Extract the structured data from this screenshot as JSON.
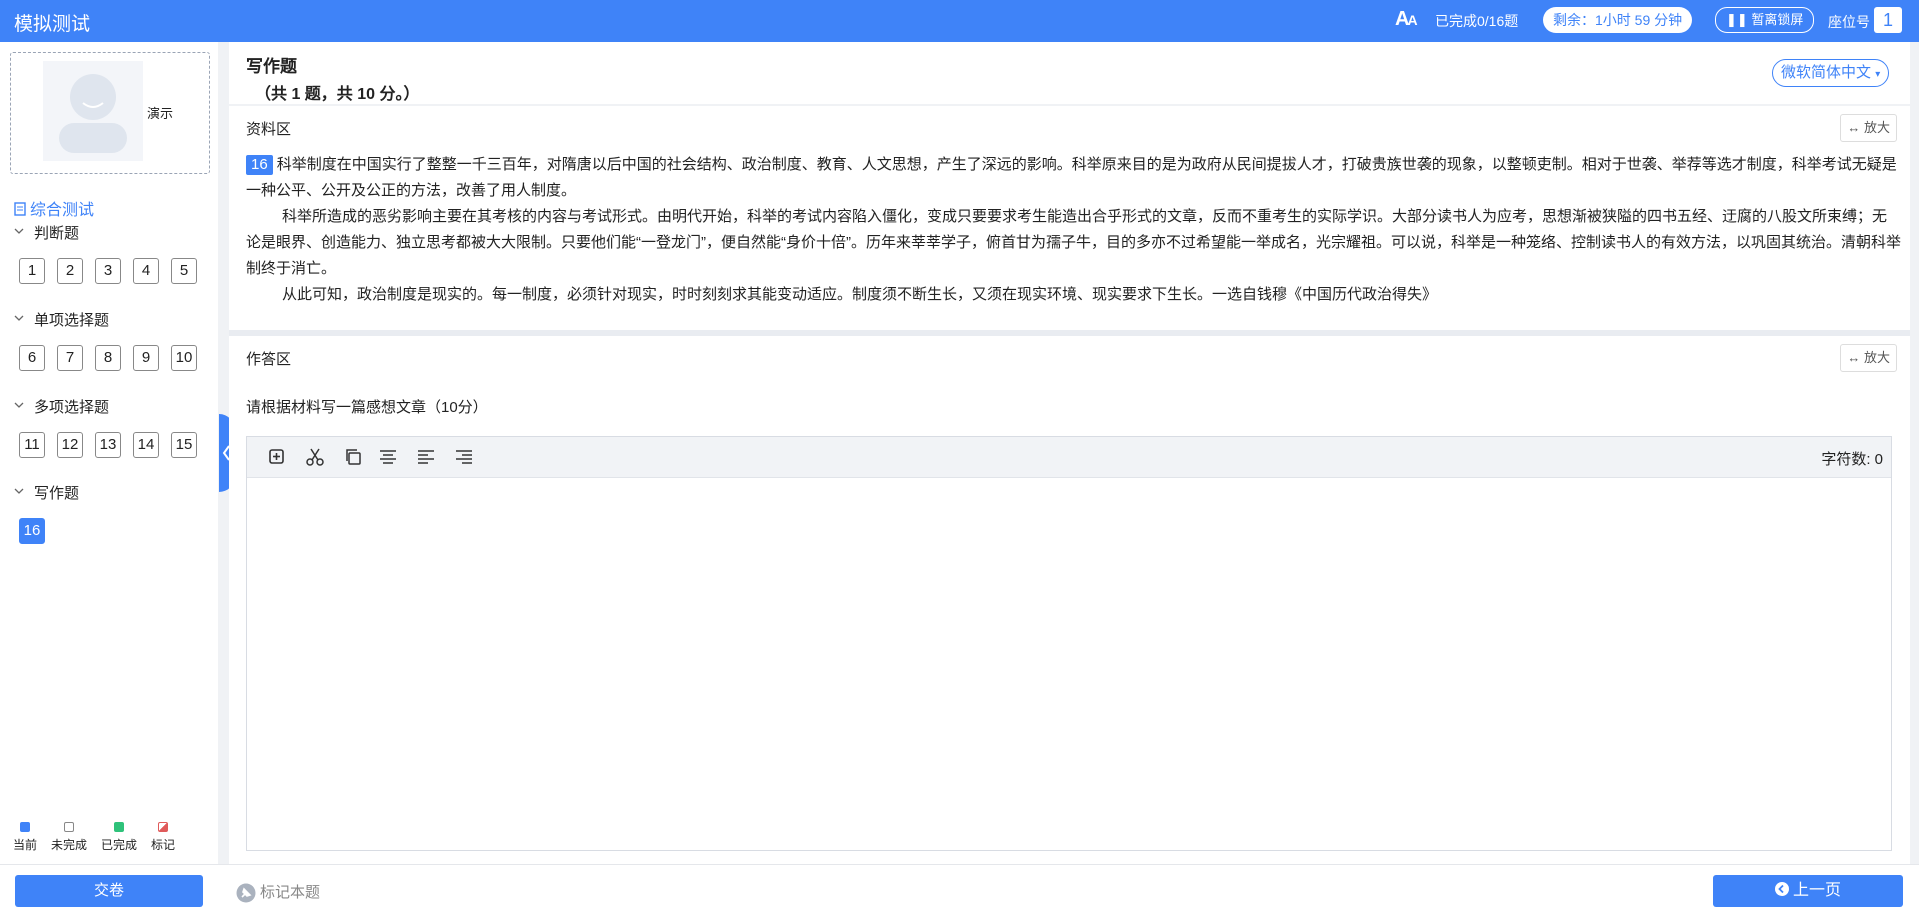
{
  "header": {
    "app_title": "模拟测试",
    "progress": "已完成0/16题",
    "timer": "剩余：1小时 59 分钟",
    "pause_label": "暂离锁屏",
    "seat_label": "座位号",
    "seat_number": "1"
  },
  "sidebar": {
    "user_name": "演示",
    "tree_root": "综合测试",
    "groups": [
      {
        "title": "判断题",
        "questions": [
          "1",
          "2",
          "3",
          "4",
          "5"
        ]
      },
      {
        "title": "单项选择题",
        "questions": [
          "6",
          "7",
          "8",
          "9",
          "10"
        ]
      },
      {
        "title": "多项选择题",
        "questions": [
          "11",
          "12",
          "13",
          "14",
          "15"
        ]
      },
      {
        "title": "写作题",
        "questions": [
          "16"
        ]
      }
    ],
    "current_question": "16",
    "legend": [
      {
        "label": "当前",
        "color": "#3f83f8"
      },
      {
        "label": "未完成",
        "color": "#ffffff"
      },
      {
        "label": "已完成",
        "color": "#2fc27a"
      },
      {
        "label": "标记",
        "color": "#e05a5a"
      }
    ]
  },
  "section": {
    "title": "写作题",
    "subtitle": "（共 1 题，共 10 分。）",
    "language": "微软简体中文"
  },
  "material": {
    "label": "资料区",
    "zoom": "放大",
    "qnum": "16",
    "paragraphs": [
      "科举制度在中国实行了整整一千三百年，对隋唐以后中国的社会结构、政治制度、教育、人文思想，产生了深远的影响。科举原来目的是为政府从民间提拔人才，打破贵族世袭的现象，以整顿吏制。相对于世袭、举荐等选才制度，科举考试无疑是一种公平、公开及公正的方法，改善了用人制度。",
      "科举所造成的恶劣影响主要在其考核的内容与考试形式。由明代开始，科举的考试内容陷入僵化，变成只要要求考生能造出合乎形式的文章，反而不重考生的实际学识。大部分读书人为应考，思想渐被狭隘的四书五经、迂腐的八股文所束缚；无论是眼界、创造能力、独立思考都被大大限制。只要他们能“一登龙门”，便自然能“身价十倍”。历年来莘莘学子，俯首甘为孺子牛，目的多亦不过希望能一举成名，光宗耀祖。可以说，科举是一种笼络、控制读书人的有效方法，以巩固其统治。清朝科举制终于消亡。",
      "从此可知，政治制度是现实的。每一制度，必须针对现实，时时刻刻求其能变动适应。制度须不断生长，又须在现实环境、现实要求下生长。一选自钱穆《中国历代政治得失》"
    ]
  },
  "answer": {
    "label": "作答区",
    "zoom": "放大",
    "prompt": "请根据材料写一篇感想文章（10分）",
    "char_count": "字符数: 0"
  },
  "footer": {
    "submit": "交卷",
    "mark": "标记本题",
    "prev": "上一页"
  }
}
